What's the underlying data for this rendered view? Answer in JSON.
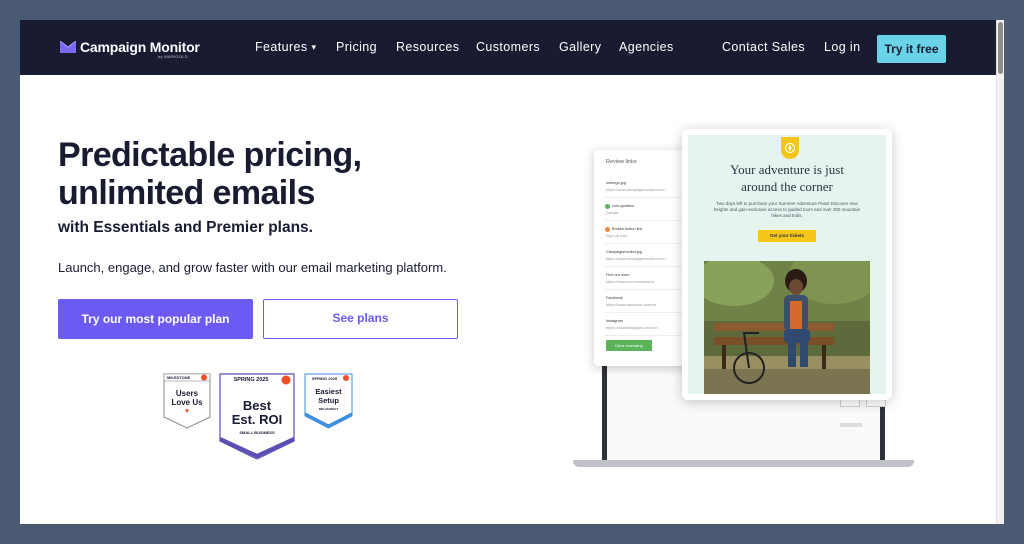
{
  "brand": {
    "name": "Campaign Monitor",
    "byline": "by MARIGOLD",
    "logo_color": "#6b5bf2"
  },
  "nav": {
    "items": [
      {
        "label": "Features"
      },
      {
        "label": "Pricing"
      },
      {
        "label": "Resources"
      },
      {
        "label": "Customers"
      },
      {
        "label": "Gallery"
      },
      {
        "label": "Agencies"
      }
    ],
    "contact": "Contact Sales",
    "login": "Log in",
    "cta": "Try it free"
  },
  "hero": {
    "headline_1": "Predictable pricing,",
    "headline_2": "unlimited emails",
    "subhead": "with Essentials and Premier plans.",
    "lede": "Launch, engage, and grow faster with our email marketing platform.",
    "primary_button": "Try our most popular plan",
    "secondary_button": "See plans"
  },
  "badges": [
    {
      "top": "MILESTONE",
      "line1": "Users",
      "line2": "Love Us",
      "extra": ""
    },
    {
      "top": "SPRING 2025",
      "line1": "Best",
      "line2": "Est. ROI",
      "extra": "SMALL BUSINESS"
    },
    {
      "top": "SPRING 2025",
      "line1": "Easiest",
      "line2": "Setup",
      "extra": "MID-MARKET"
    }
  ],
  "review_panel": {
    "title": "Review links",
    "items": [
      {
        "a": "onthego.jpg",
        "b": "https://www.campaignmonitor.com/..."
      },
      {
        "a": "Link updated",
        "b": "Donate"
      },
      {
        "a": "Broken button link",
        "b": "Sign up now"
      },
      {
        "a": "Campaignmonitor.jpg",
        "b": "https://www.campaignmonitor.com/..."
      },
      {
        "a": "Find out more",
        "b": "https://www.cm.com/aboutus"
      },
      {
        "a": "Facebook",
        "b": "https://www.facebook.com/cm"
      },
      {
        "a": "Instagram",
        "b": "https://www.instagram.com/cm"
      }
    ],
    "done": "Done reviewing"
  },
  "email_preview": {
    "headline_1": "Your adventure is just",
    "headline_2": "around the corner",
    "body": "Two days left to purchase your Summer Adventure Pass! Discover new heights and gain exclusive access to guided tours and over 300 mountain hikes and trails.",
    "button": "Get your tickets"
  },
  "colors": {
    "nav_bg": "#191b31",
    "accent": "#6b5bf2",
    "cta": "#6ad3e8",
    "yellow": "#f8cc1b",
    "g2_red": "#f04d2c"
  }
}
